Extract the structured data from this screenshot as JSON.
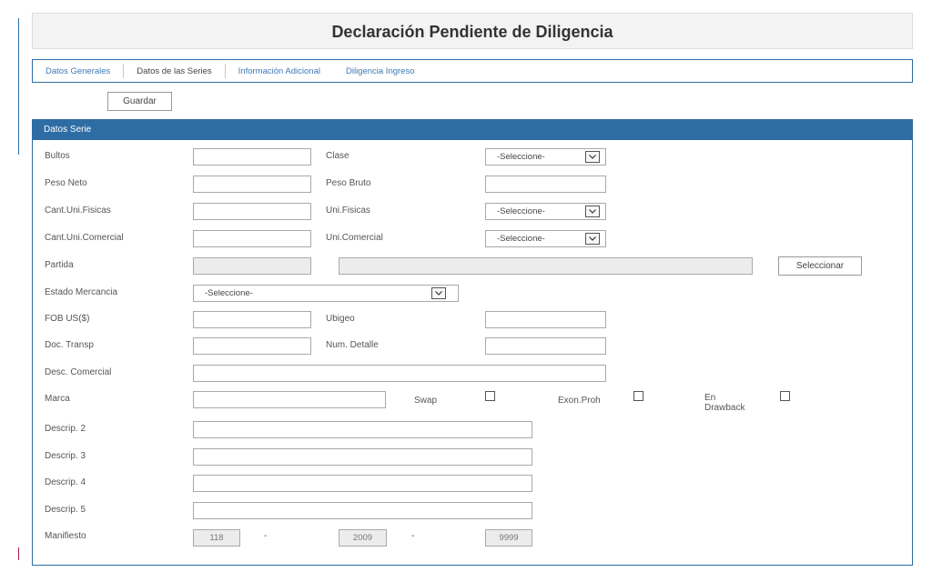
{
  "header": {
    "title": "Declaración Pendiente de Diligencia"
  },
  "tabs": [
    {
      "label": "Datos Generales"
    },
    {
      "label": "Datos de las Series"
    },
    {
      "label": "Información Adicional"
    },
    {
      "label": "Diligencia Ingreso"
    }
  ],
  "active_tab": "Datos de las Series",
  "toolbar": {
    "save_label": "Guardar"
  },
  "panel": {
    "title": "Datos Serie"
  },
  "form": {
    "bultos": {
      "label": "Bultos",
      "value": ""
    },
    "clase": {
      "label": "Clase",
      "value": "-Seleccione-"
    },
    "peso_neto": {
      "label": "Peso Neto",
      "value": ""
    },
    "peso_bruto": {
      "label": "Peso Bruto",
      "value": ""
    },
    "cant_uni_fisicas": {
      "label": "Cant.Uni.Fisicas",
      "value": ""
    },
    "uni_fisicas": {
      "label": "Uni.Fisicas",
      "value": "-Seleccione-"
    },
    "cant_uni_comercial": {
      "label": "Cant.Uni.Comercial",
      "value": ""
    },
    "uni_comercial": {
      "label": "Uni.Comercial",
      "value": "-Seleccione-"
    },
    "partida": {
      "label": "Partida",
      "code": "",
      "description": "",
      "button": "Seleccionar"
    },
    "estado_mercancia": {
      "label": "Estado Mercancia",
      "value": "-Seleccione-"
    },
    "fob": {
      "label": "FOB US($)",
      "value": ""
    },
    "ubigeo": {
      "label": "Ubigeo",
      "value": ""
    },
    "doc_transp": {
      "label": "Doc. Transp",
      "value": ""
    },
    "num_detalle": {
      "label": "Num. Detalle",
      "value": ""
    },
    "desc_comercial": {
      "label": "Desc. Comercial",
      "value": ""
    },
    "marca": {
      "label": "Marca",
      "value": ""
    },
    "swap": {
      "label": "Swap",
      "checked": false
    },
    "exon_proh": {
      "label": "Exon.Proh",
      "checked": false
    },
    "en_drawback": {
      "label_line1": "En",
      "label_line2": "Drawback",
      "checked": false
    },
    "descrip2": {
      "label": "Descrip. 2",
      "value": ""
    },
    "descrip3": {
      "label": "Descrip. 3",
      "value": ""
    },
    "descrip4": {
      "label": "Descrip. 4",
      "value": ""
    },
    "descrip5": {
      "label": "Descrip. 5",
      "value": ""
    },
    "manifiesto": {
      "label": "Manifiesto",
      "part1": "118",
      "sep1": "-",
      "part2": "2009",
      "sep2": "-",
      "part3": "9999"
    }
  },
  "colors": {
    "accent": "#2e6da4",
    "link": "#3c7ab7",
    "title_bg": "#f3f3f3",
    "readonly_bg": "#ececec"
  },
  "icons": {
    "select_arrow": "chevron-down-icon"
  }
}
